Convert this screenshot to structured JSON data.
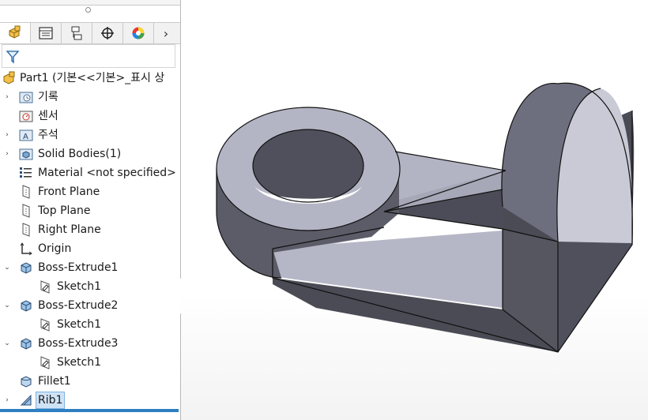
{
  "feature_manager": {
    "tabs": [
      {
        "name": "featuremanager-tab",
        "icon": "featuremanager-icon"
      },
      {
        "name": "propertymanager-tab",
        "icon": "propertymanager-icon"
      },
      {
        "name": "configurationmanager-tab",
        "icon": "configurationmanager-icon"
      },
      {
        "name": "dimxpertmanager-tab",
        "icon": "dimxpert-icon"
      },
      {
        "name": "displaymanager-tab",
        "icon": "displaymanager-icon"
      }
    ],
    "more_tabs_label": "›",
    "root": {
      "label": "Part1  (기본<<기본>_표시 상",
      "icon": "part-icon"
    },
    "items": [
      {
        "label": "기록",
        "icon": "history-icon",
        "expand": "›"
      },
      {
        "label": "센서",
        "icon": "sensor-icon",
        "expand": ""
      },
      {
        "label": "주석",
        "icon": "annotations-icon",
        "expand": "›"
      },
      {
        "label": "Solid Bodies(1)",
        "icon": "solid-bodies-icon",
        "expand": "›"
      },
      {
        "label": "Material <not specified>",
        "icon": "material-icon",
        "expand": ""
      },
      {
        "label": "Front Plane",
        "icon": "plane-icon",
        "expand": ""
      },
      {
        "label": "Top Plane",
        "icon": "plane-icon",
        "expand": ""
      },
      {
        "label": "Right Plane",
        "icon": "plane-icon",
        "expand": ""
      },
      {
        "label": "Origin",
        "icon": "origin-icon",
        "expand": ""
      },
      {
        "label": "Boss-Extrude1",
        "icon": "extrude-icon",
        "expand": "⌄"
      },
      {
        "label": "Sketch1",
        "icon": "sketch-icon",
        "expand": "",
        "child": true
      },
      {
        "label": "Boss-Extrude2",
        "icon": "extrude-icon",
        "expand": "⌄"
      },
      {
        "label": "Sketch1",
        "icon": "sketch-icon",
        "expand": "",
        "child": true
      },
      {
        "label": "Boss-Extrude3",
        "icon": "extrude-icon",
        "expand": "⌄"
      },
      {
        "label": "Sketch1",
        "icon": "sketch-icon",
        "expand": "",
        "child": true
      },
      {
        "label": "Fillet1",
        "icon": "fillet-icon",
        "expand": ""
      },
      {
        "label": "Rib1",
        "icon": "rib-icon",
        "expand": "›",
        "selected": true
      }
    ]
  },
  "colors": {
    "model_top": "#b6b7c6",
    "model_side": "#4a4b55",
    "model_mid": "#6b6c79",
    "selection": "#cfe3f7",
    "accent": "#2e7fc1"
  }
}
